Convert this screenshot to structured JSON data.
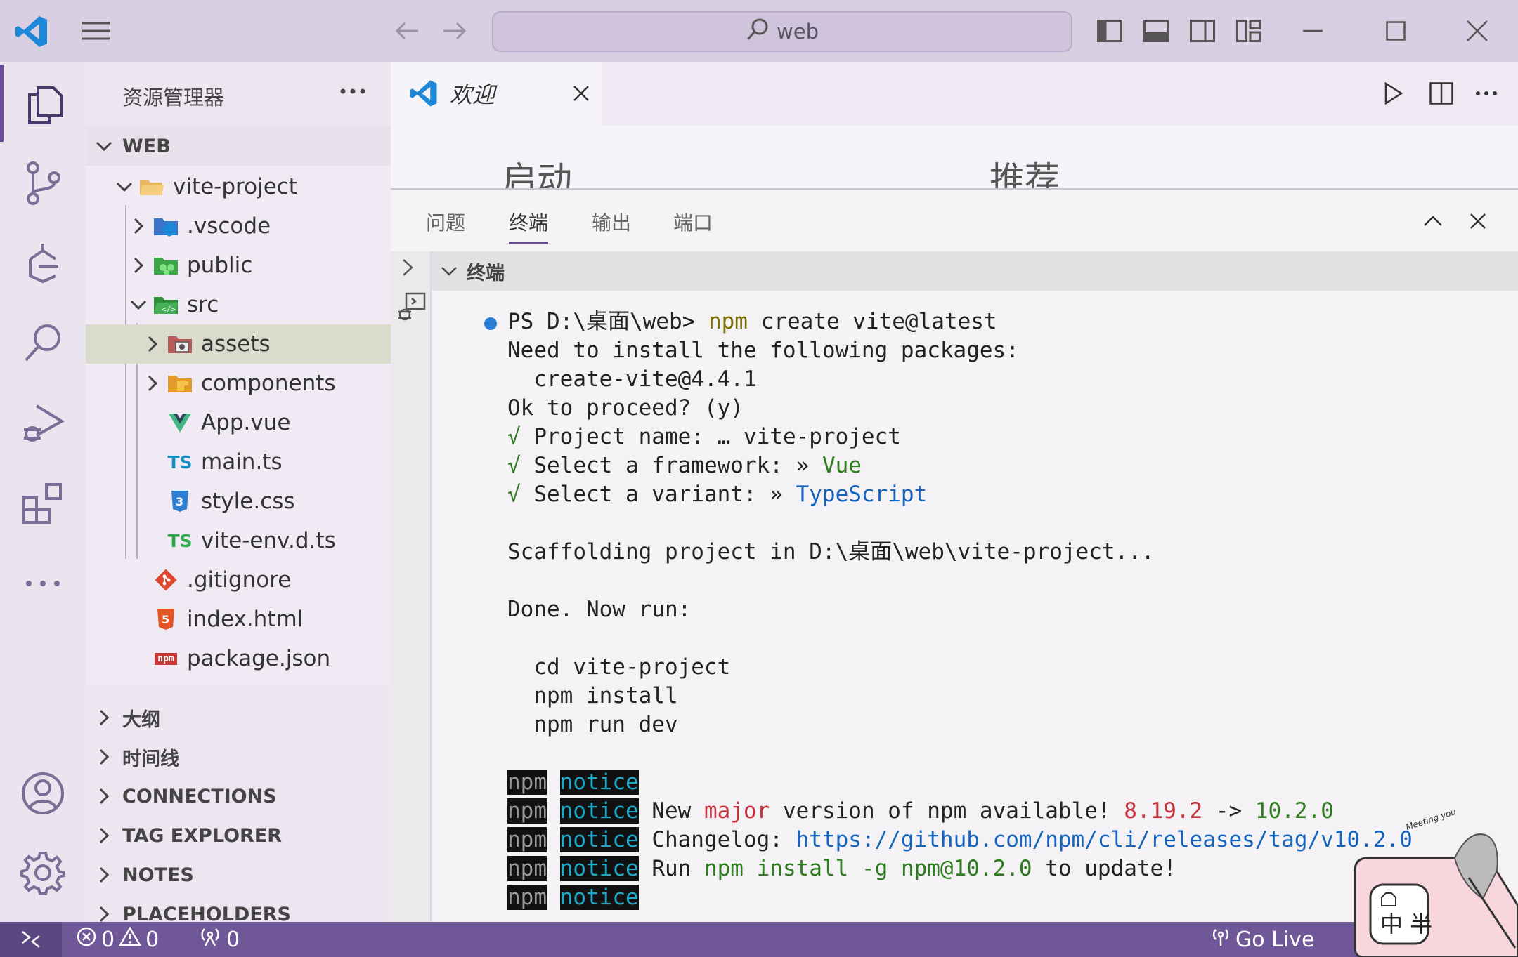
{
  "window": {
    "search_text": "web"
  },
  "explorer": {
    "title": "资源管理器",
    "workspace": "WEB",
    "tree": [
      {
        "label": "vite-project",
        "kind": "folder-open",
        "depth": 0
      },
      {
        "label": ".vscode",
        "kind": "folder-vscode",
        "depth": 1
      },
      {
        "label": "public",
        "kind": "folder-public",
        "depth": 1
      },
      {
        "label": "src",
        "kind": "folder-src",
        "depth": 1
      },
      {
        "label": "assets",
        "kind": "folder-assets",
        "depth": 2
      },
      {
        "label": "components",
        "kind": "folder-components",
        "depth": 2
      },
      {
        "label": "App.vue",
        "kind": "vue",
        "depth": 2
      },
      {
        "label": "main.ts",
        "kind": "ts",
        "depth": 2
      },
      {
        "label": "style.css",
        "kind": "css",
        "depth": 2
      },
      {
        "label": "vite-env.d.ts",
        "kind": "ts",
        "depth": 2
      },
      {
        "label": ".gitignore",
        "kind": "git",
        "depth": 1
      },
      {
        "label": "index.html",
        "kind": "html",
        "depth": 1
      },
      {
        "label": "package.json",
        "kind": "npm",
        "depth": 1
      }
    ],
    "ts_badge": "TS",
    "npm_badge": "npm",
    "sections": [
      "大纲",
      "时间线",
      "CONNECTIONS",
      "TAG EXPLORER",
      "NOTES",
      "PLACEHOLDERS"
    ]
  },
  "editor": {
    "tab_label": "欢迎",
    "welcome_start": "启动",
    "welcome_recommended": "推荐"
  },
  "panel": {
    "tabs": [
      "问题",
      "终端",
      "输出",
      "端口"
    ],
    "active_tab": "终端",
    "terminal_header": "终端",
    "lines": {
      "l1_prompt": "PS D:\\桌面\\web> ",
      "l1_cmd": "npm",
      "l1_rest": " create vite@latest",
      "l2": "Need to install the following packages:",
      "l3": "  create-vite@4.4.1",
      "l4": "Ok to proceed? (y)",
      "l5_check": "√",
      "l5_text": " Project name: … vite-project",
      "l6_check": "√",
      "l6_text": " Select a framework: » ",
      "l6_value": "Vue",
      "l7_check": "√",
      "l7_text": " Select a variant: » ",
      "l7_value": "TypeScript",
      "l8": "Scaffolding project in D:\\桌面\\web\\vite-project...",
      "l9": "Done. Now run:",
      "l10": "  cd vite-project",
      "l11": "  npm install",
      "l12": "  npm run dev",
      "npm": "npm",
      "notice": "notice",
      "n2_a": " New ",
      "n2_major": "major",
      "n2_b": " version of npm available! ",
      "n2_old": "8.19.2",
      "n2_arrow": " -> ",
      "n2_new": "10.2.0",
      "n3_a": " Changelog: ",
      "n3_url": "https://github.com/npm/cli/releases/tag/v10.2.0",
      "n4_a": " Run ",
      "n4_cmd": "npm install -g npm@10.2.0",
      "n4_b": " to update!"
    }
  },
  "status": {
    "errors": "0",
    "warnings": "0",
    "ports": "0",
    "go_live": "Go Live"
  },
  "sticker": {
    "text": "中 半",
    "caption": "Meeting you"
  },
  "colors": {
    "accent": "#6b4d9c",
    "titlebar": "#d9cfe3",
    "statusbar": "#6f5798"
  }
}
